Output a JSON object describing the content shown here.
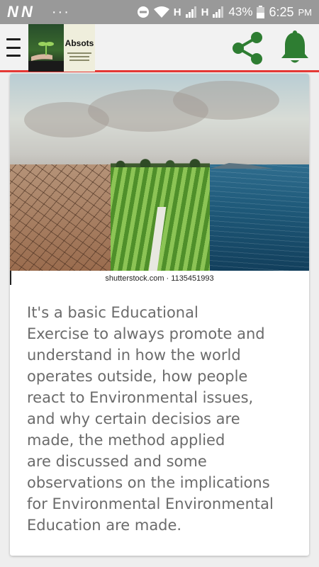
{
  "status_bar": {
    "notif_left": "N N",
    "more_dots": "···",
    "network_1": "H",
    "network_2": "H",
    "battery": "43%",
    "time": "6:25",
    "ampm": "PM"
  },
  "app_bar": {
    "logo_text": "Absots",
    "accent_color": "#e53935",
    "icon_color": "#2e7d32"
  },
  "article": {
    "image_caption": "shutterstock.com · 1135451993",
    "body": "It's a basic Educational\nExercise to always promote and\nunderstand in how the world\noperates outside, how people\nreact to Environmental issues,\nand why certain decisios are\nmade, the method applied\nare discussed and some\nobservations on the implications\nfor Environmental Environmental\nEducation are made."
  }
}
